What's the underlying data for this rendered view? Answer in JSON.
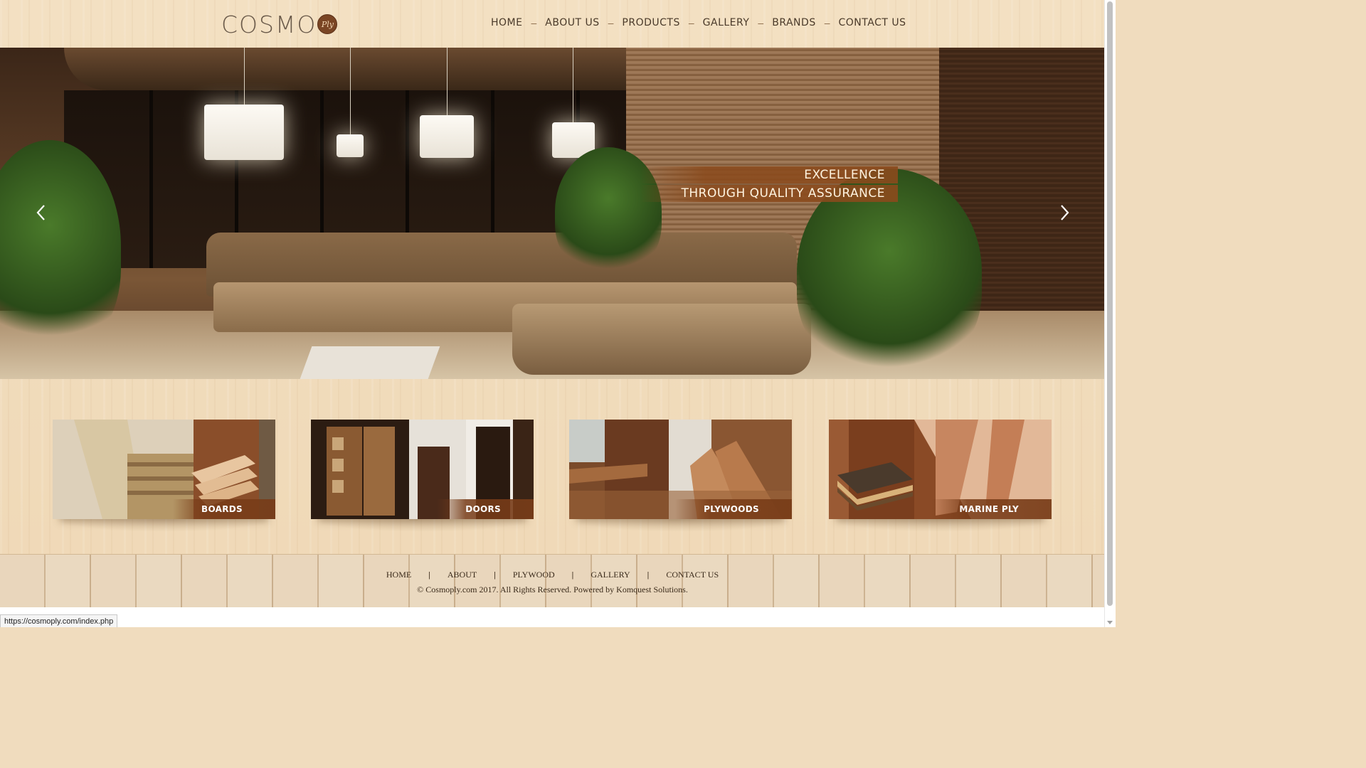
{
  "header": {
    "logo_text": "COSMO",
    "logo_badge": "Ply",
    "nav": [
      {
        "label": "HOME"
      },
      {
        "label": "ABOUT US"
      },
      {
        "label": "PRODUCTS"
      },
      {
        "label": "GALLERY"
      },
      {
        "label": "BRANDS"
      },
      {
        "label": "CONTACT US"
      }
    ],
    "nav_separator": "–"
  },
  "slider": {
    "tagline_line1": "EXCELLENCE",
    "tagline_line2": "THROUGH QUALITY ASSURANCE",
    "prev_icon": "chevron-left-icon",
    "next_icon": "chevron-right-icon"
  },
  "products": [
    {
      "label": "BOARDS"
    },
    {
      "label": "DOORS"
    },
    {
      "label": "PLYWOODS"
    },
    {
      "label": "MARINE PLY"
    }
  ],
  "footer": {
    "nav": [
      {
        "label": "HOME"
      },
      {
        "label": "ABOUT"
      },
      {
        "label": "PLYWOOD"
      },
      {
        "label": "GALLERY"
      },
      {
        "label": "CONTACT US"
      }
    ],
    "separator": "|",
    "copyright": "© Cosmoply.com 2017. All Rights Reserved. Powered by Komquest Solutions."
  },
  "status_bar": {
    "url": "https://cosmoply.com/index.php"
  },
  "colors": {
    "accent_brown": "#8a4a1c",
    "page_background": "#f0dcbe",
    "nav_text": "#4a3a2a"
  }
}
